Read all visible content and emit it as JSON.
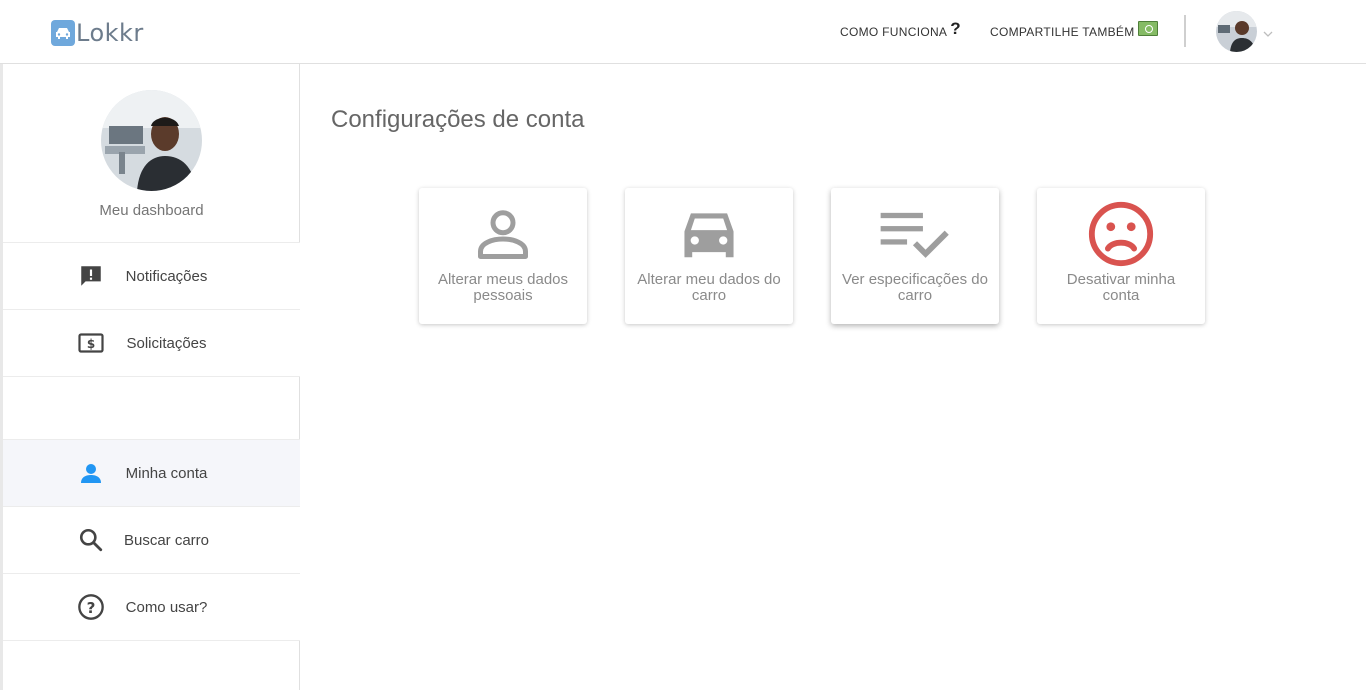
{
  "header": {
    "logo_text": "Lokkr",
    "nav_how_label": "COMO FUNCIONA",
    "nav_share_label": "COMPARTILHE TAMBÉM"
  },
  "sidebar": {
    "dashboard_label": "Meu dashboard",
    "items": [
      {
        "label": "Notificações",
        "icon": "notification-icon"
      },
      {
        "label": "Solicitações",
        "icon": "money-icon"
      },
      {
        "label": "Minha conta",
        "icon": "person-icon",
        "active": true
      },
      {
        "label": "Buscar carro",
        "icon": "search-icon"
      },
      {
        "label": "Como usar?",
        "icon": "help-icon"
      }
    ]
  },
  "main": {
    "title": "Configurações de conta",
    "cards": [
      {
        "label": "Alterar meus dados pessoais",
        "icon": "person-icon"
      },
      {
        "label": "Alterar meu dados do carro",
        "icon": "car-icon"
      },
      {
        "label": "Ver especificações do carro",
        "icon": "checklist-icon"
      },
      {
        "label": "Desativar minha conta",
        "icon": "sad-face-icon"
      }
    ]
  },
  "colors": {
    "accent": "#2196f3",
    "logo": "#6fa8dc",
    "danger": "#d9534f",
    "icon_gray": "#9e9e9e"
  }
}
